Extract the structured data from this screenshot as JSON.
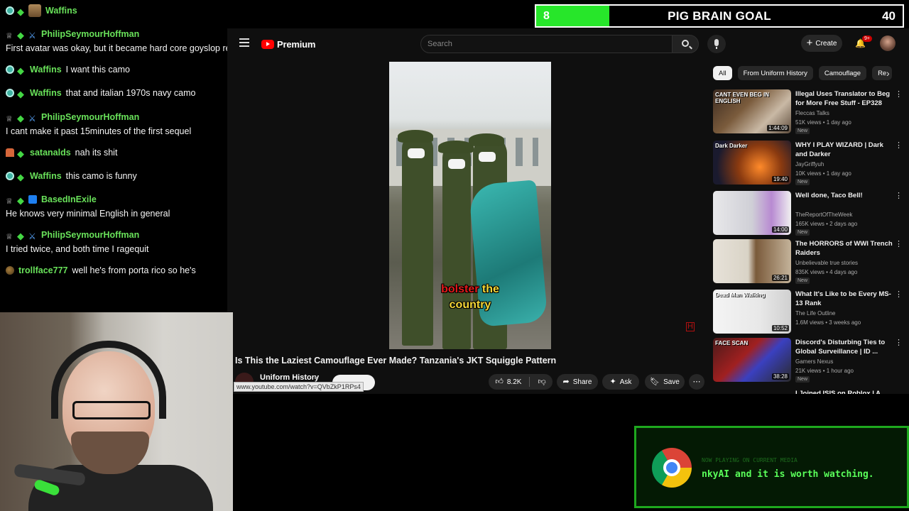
{
  "chat": {
    "messages": [
      {
        "user": "Waffins",
        "text": "",
        "badges": [
          "sub",
          "gem",
          "avatar"
        ]
      },
      {
        "user": "PhilipSeymourHoffman",
        "text": "First avatar was okay, but it became hard core goyslop real fast",
        "badges": [
          "crown",
          "gem",
          "sword"
        ]
      },
      {
        "user": "Waffins",
        "text": "I want this camo",
        "badges": [
          "sub",
          "gem"
        ]
      },
      {
        "user": "Waffins",
        "text": "that and italian 1970s navy camo",
        "badges": [
          "sub",
          "gem"
        ]
      },
      {
        "user": "PhilipSeymourHoffman",
        "text": "I cant make it past 15minutes of the first sequel",
        "badges": [
          "crown",
          "gem",
          "sword"
        ]
      },
      {
        "user": "satanalds",
        "text": "nah its shit",
        "badges": [
          "hat",
          "gem"
        ]
      },
      {
        "user": "Waffins",
        "text": "this camo is funny",
        "badges": [
          "sub",
          "gem"
        ]
      },
      {
        "user": "BasedInExile",
        "text": "He knows very minimal English in general",
        "badges": [
          "crown",
          "gem",
          "cube"
        ]
      },
      {
        "user": "PhilipSeymourHoffman",
        "text": "I tried twice, and both time I ragequit",
        "badges": [
          "crown",
          "gem",
          "sword"
        ]
      },
      {
        "user": "trollface777",
        "text": "well he's from porta rico so he's",
        "badges": [
          "ball"
        ]
      }
    ]
  },
  "goal": {
    "current": "8",
    "title": "PIG BRAIN GOAL",
    "target": "40",
    "progress_fraction": 0.2,
    "fill_color": "#27e62a"
  },
  "youtube": {
    "logo_text": "Premium",
    "search_placeholder": "Search",
    "create_label": "Create",
    "notification_count": "9+",
    "video": {
      "caption_words": [
        "bolster",
        "the",
        "country"
      ],
      "title": "Is This the Laziest Camouflage Ever Made? Tanzania's JKT Squiggle Pattern",
      "channel": "Uniform History",
      "url_tooltip": "www.youtube.com/watch?v=QVbZkP1RPs4",
      "watermark": "H",
      "likes": "8.2K",
      "share_label": "Share",
      "ask_label": "Ask",
      "save_label": "Save"
    },
    "chips": [
      "All",
      "From Uniform History",
      "Camouflage",
      "Re"
    ],
    "recommendations": [
      {
        "title": "Illegal Uses Translator to Beg for More Free Stuff - EP328",
        "channel": "Fleccas Talks",
        "views": "51K views",
        "age": "1 day ago",
        "duration": "1:44:09",
        "new": "New",
        "thumb": "linear-gradient(135deg,#3b2a20,#7a5b3c 40%,#c9b9a5 70%,#5e4c3c)",
        "thumb_text": "CANT EVEN BEG IN ENGLISH"
      },
      {
        "title": "WHY I PLAY WIZARD | Dark and Darker",
        "channel": "JayGriffyuh",
        "views": "10K views",
        "age": "1 day ago",
        "duration": "19:40",
        "new": "New",
        "thumb": "radial-gradient(circle at 60% 60%,#ff8a2a,#8a3a10 40%,#1a1a2e 80%)",
        "thumb_text": "Dark Darker"
      },
      {
        "title": "Well done, Taco Bell!",
        "channel": "TheReportOfTheWeek",
        "views": "165K views",
        "age": "2 days ago",
        "duration": "14:00",
        "new": "New",
        "thumb": "linear-gradient(90deg,#e8e8ea,#cfcfd6 50%,#b88ad2 75%,#f0f0f0)",
        "thumb_text": ""
      },
      {
        "title": "The HORRORS of WWI Trench Raiders",
        "channel": "Unbelievable true stories",
        "views": "835K views",
        "age": "4 days ago",
        "duration": "26:21",
        "new": "New",
        "thumb": "linear-gradient(90deg,#e7e2d9 0%,#d9d3c6 45%,#7a5a3a 55%,#c4b39a 100%)",
        "thumb_text": ""
      },
      {
        "title": "What It's Like to be Every MS-13 Rank",
        "channel": "The Life Outline",
        "views": "1.6M views",
        "age": "3 weeks ago",
        "duration": "10:52",
        "new": "",
        "thumb": "linear-gradient(90deg,#f4f4f4 0%,#e8e8e8 60%,#d0d0d0 100%)",
        "thumb_text": "Dead Man Walking"
      },
      {
        "title": "Discord's Disturbing Ties to Global Surveillance | ID ...",
        "channel": "Gamers Nexus",
        "views": "21K views",
        "age": "1 hour ago",
        "duration": "38:28",
        "new": "New",
        "thumb": "linear-gradient(135deg,#4a1a1a,#a02020 40%,#3a40c0 60%,#2a2a2a)",
        "thumb_text": "FACE SCAN"
      }
    ],
    "partial_next_title": "I Joined ISIS on Roblox | A ..."
  },
  "notification": {
    "line1": "NOW PLAYING ON CURRENT MEDIA",
    "line2": "nkyAI and it is worth watching."
  }
}
